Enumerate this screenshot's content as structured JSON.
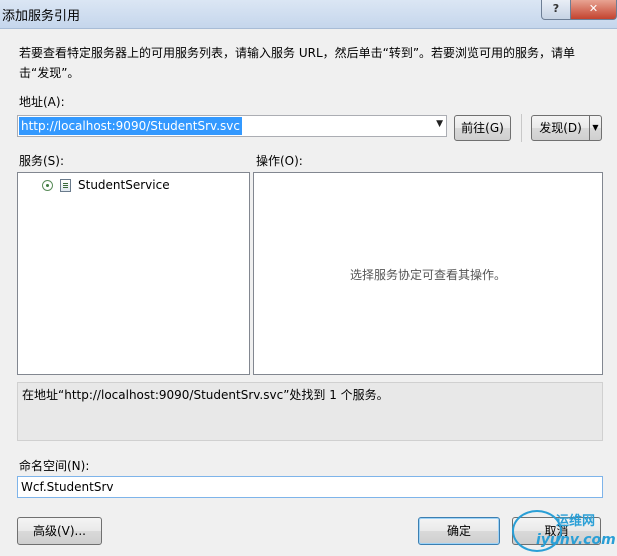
{
  "window": {
    "title": "添加服务引用",
    "help_label": "?",
    "close_label": "✕"
  },
  "instructions": "若要查看特定服务器上的可用服务列表，请输入服务 URL，然后单击“转到”。若要浏览可用的服务，请单击“发现”。",
  "address": {
    "label": "地址(A):",
    "value": "http://localhost:9090/StudentSrv.svc",
    "dropdown_icon": "▼"
  },
  "buttons": {
    "go": "前往(G)",
    "discover": "发现(D)",
    "discover_dropdown": "▼",
    "advanced": "高级(V)...",
    "ok": "确定",
    "cancel": "取消"
  },
  "services": {
    "label": "服务(S):",
    "items": [
      {
        "label": "StudentService",
        "icon": "service-icon"
      }
    ]
  },
  "operations": {
    "label": "操作(O):",
    "placeholder": "选择服务协定可查看其操作。"
  },
  "status_message": "在地址“http://localhost:9090/StudentSrv.svc”处找到 1 个服务。",
  "namespace": {
    "label": "命名空间(N):",
    "value": "Wcf.StudentSrv"
  },
  "watermark": {
    "brand": "运维网",
    "url": "iyunv.com"
  }
}
